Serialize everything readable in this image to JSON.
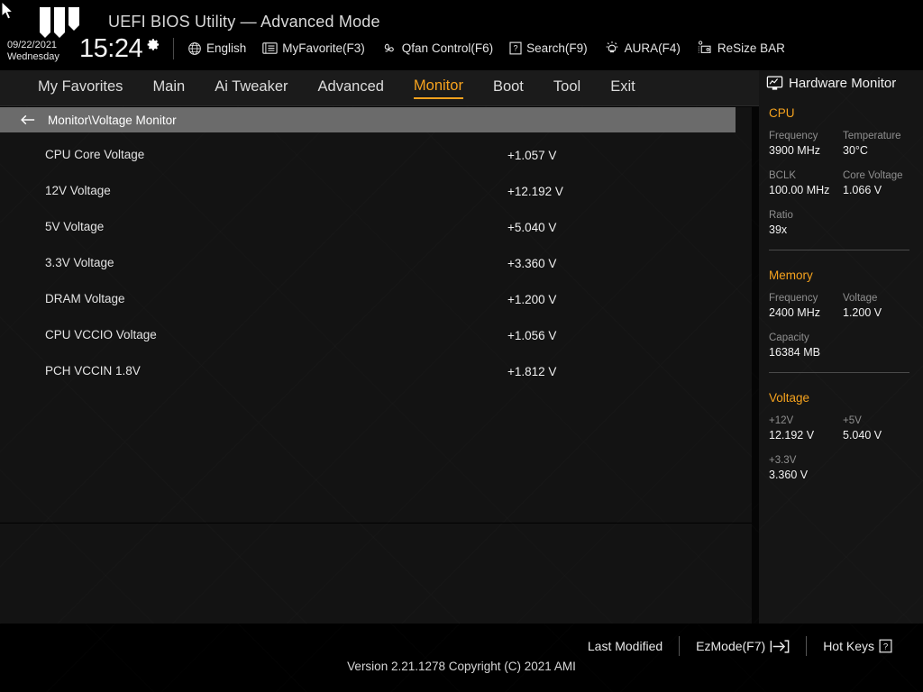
{
  "header": {
    "title": "UEFI BIOS Utility — Advanced Mode",
    "logo_name": "tuf-gaming-logo",
    "date": "09/22/2021",
    "weekday": "Wednesday",
    "time": "15:24",
    "gear_icon": "gear-icon",
    "toolbar": [
      {
        "label": "English",
        "icon": "globe-icon"
      },
      {
        "label": "MyFavorite(F3)",
        "icon": "list-icon"
      },
      {
        "label": "Qfan Control(F6)",
        "icon": "fan-icon"
      },
      {
        "label": "Search(F9)",
        "icon": "question-box-icon"
      },
      {
        "label": "AURA(F4)",
        "icon": "lightbulb-icon"
      },
      {
        "label": "ReSize BAR",
        "icon": "resize-bar-icon"
      }
    ]
  },
  "nav": {
    "tabs": [
      {
        "label": "My Favorites",
        "active": false
      },
      {
        "label": "Main",
        "active": false
      },
      {
        "label": "Ai Tweaker",
        "active": false
      },
      {
        "label": "Advanced",
        "active": false
      },
      {
        "label": "Monitor",
        "active": true
      },
      {
        "label": "Boot",
        "active": false
      },
      {
        "label": "Tool",
        "active": false
      },
      {
        "label": "Exit",
        "active": false
      }
    ],
    "accent_color": "#f5a21e"
  },
  "breadcrumb": {
    "back_icon": "back-arrow-icon",
    "path": "Monitor\\Voltage Monitor"
  },
  "main": {
    "info_icon": "info-icon",
    "rows": [
      {
        "label": "CPU Core Voltage",
        "value": "+1.057 V"
      },
      {
        "label": "12V Voltage",
        "value": "+12.192 V"
      },
      {
        "label": "5V Voltage",
        "value": "+5.040 V"
      },
      {
        "label": "3.3V Voltage",
        "value": "+3.360 V"
      },
      {
        "label": "DRAM Voltage",
        "value": "+1.200 V"
      },
      {
        "label": "CPU VCCIO Voltage",
        "value": "+1.056 V"
      },
      {
        "label": "PCH VCCIN 1.8V",
        "value": "+1.812 V"
      }
    ]
  },
  "sidebar": {
    "title": "Hardware Monitor",
    "title_icon": "monitor-chart-icon",
    "sections": [
      {
        "name": "CPU",
        "pairs": [
          [
            {
              "key": "Frequency",
              "value": "3900 MHz"
            },
            {
              "key": "Temperature",
              "value": "30°C"
            }
          ],
          [
            {
              "key": "BCLK",
              "value": "100.00 MHz"
            },
            {
              "key": "Core Voltage",
              "value": "1.066 V"
            }
          ],
          [
            {
              "key": "Ratio",
              "value": "39x"
            }
          ]
        ]
      },
      {
        "name": "Memory",
        "pairs": [
          [
            {
              "key": "Frequency",
              "value": "2400 MHz"
            },
            {
              "key": "Voltage",
              "value": "1.200 V"
            }
          ],
          [
            {
              "key": "Capacity",
              "value": "16384 MB"
            }
          ]
        ]
      },
      {
        "name": "Voltage",
        "pairs": [
          [
            {
              "key": "+12V",
              "value": "12.192 V"
            },
            {
              "key": "+5V",
              "value": "5.040 V"
            }
          ],
          [
            {
              "key": "+3.3V",
              "value": "3.360 V"
            }
          ]
        ]
      }
    ]
  },
  "footer": {
    "last_modified": "Last Modified",
    "ez_mode": "EzMode(F7)",
    "ez_mode_icon": "arrow-into-bracket-icon",
    "hot_keys": "Hot Keys",
    "hot_keys_icon": "question-box-icon",
    "version": "Version 2.21.1278 Copyright (C) 2021 AMI"
  }
}
